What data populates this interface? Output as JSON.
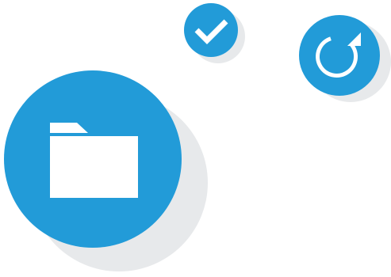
{
  "colors": {
    "background": "#ffffff",
    "circle": "#229bd8",
    "shadow": "#e7e9eb",
    "icon": "#ffffff"
  },
  "icons": {
    "check": {
      "name": "check-icon"
    },
    "refresh": {
      "name": "refresh-icon"
    },
    "folder": {
      "name": "folder-icon"
    }
  }
}
